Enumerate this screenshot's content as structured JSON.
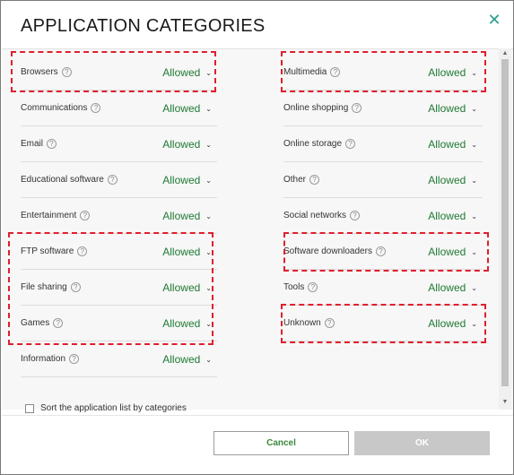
{
  "dialog": {
    "title": "APPLICATION CATEGORIES",
    "close_glyph": "✕"
  },
  "left_column": [
    {
      "name": "Browsers",
      "value": "Allowed",
      "highlighted": true
    },
    {
      "name": "Communications",
      "value": "Allowed",
      "highlighted": false
    },
    {
      "name": "Email",
      "value": "Allowed",
      "highlighted": false
    },
    {
      "name": "Educational software",
      "value": "Allowed",
      "highlighted": false
    },
    {
      "name": "Entertainment",
      "value": "Allowed",
      "highlighted": false
    },
    {
      "name": "FTP software",
      "value": "Allowed",
      "highlighted": true
    },
    {
      "name": "File sharing",
      "value": "Allowed",
      "highlighted": true
    },
    {
      "name": "Games",
      "value": "Allowed",
      "highlighted": true
    },
    {
      "name": "Information",
      "value": "Allowed",
      "highlighted": false
    }
  ],
  "right_column": [
    {
      "name": "Multimedia",
      "value": "Allowed",
      "highlighted": true
    },
    {
      "name": "Online shopping",
      "value": "Allowed",
      "highlighted": false
    },
    {
      "name": "Online storage",
      "value": "Allowed",
      "highlighted": false
    },
    {
      "name": "Other",
      "value": "Allowed",
      "highlighted": false
    },
    {
      "name": "Social networks",
      "value": "Allowed",
      "highlighted": false
    },
    {
      "name": "Software downloaders",
      "value": "Allowed",
      "highlighted": true
    },
    {
      "name": "Tools",
      "value": "Allowed",
      "highlighted": false
    },
    {
      "name": "Unknown",
      "value": "Allowed",
      "highlighted": true
    }
  ],
  "help_glyph": "?",
  "chevron_glyph": "⌄",
  "sort": {
    "label": "Sort the application list by categories",
    "checked": false
  },
  "buttons": {
    "cancel": "Cancel",
    "ok": "OK"
  },
  "colors": {
    "allowed_text": "#1f7a34",
    "accent": "#2aa08a",
    "highlight_border": "#e01f2d"
  }
}
